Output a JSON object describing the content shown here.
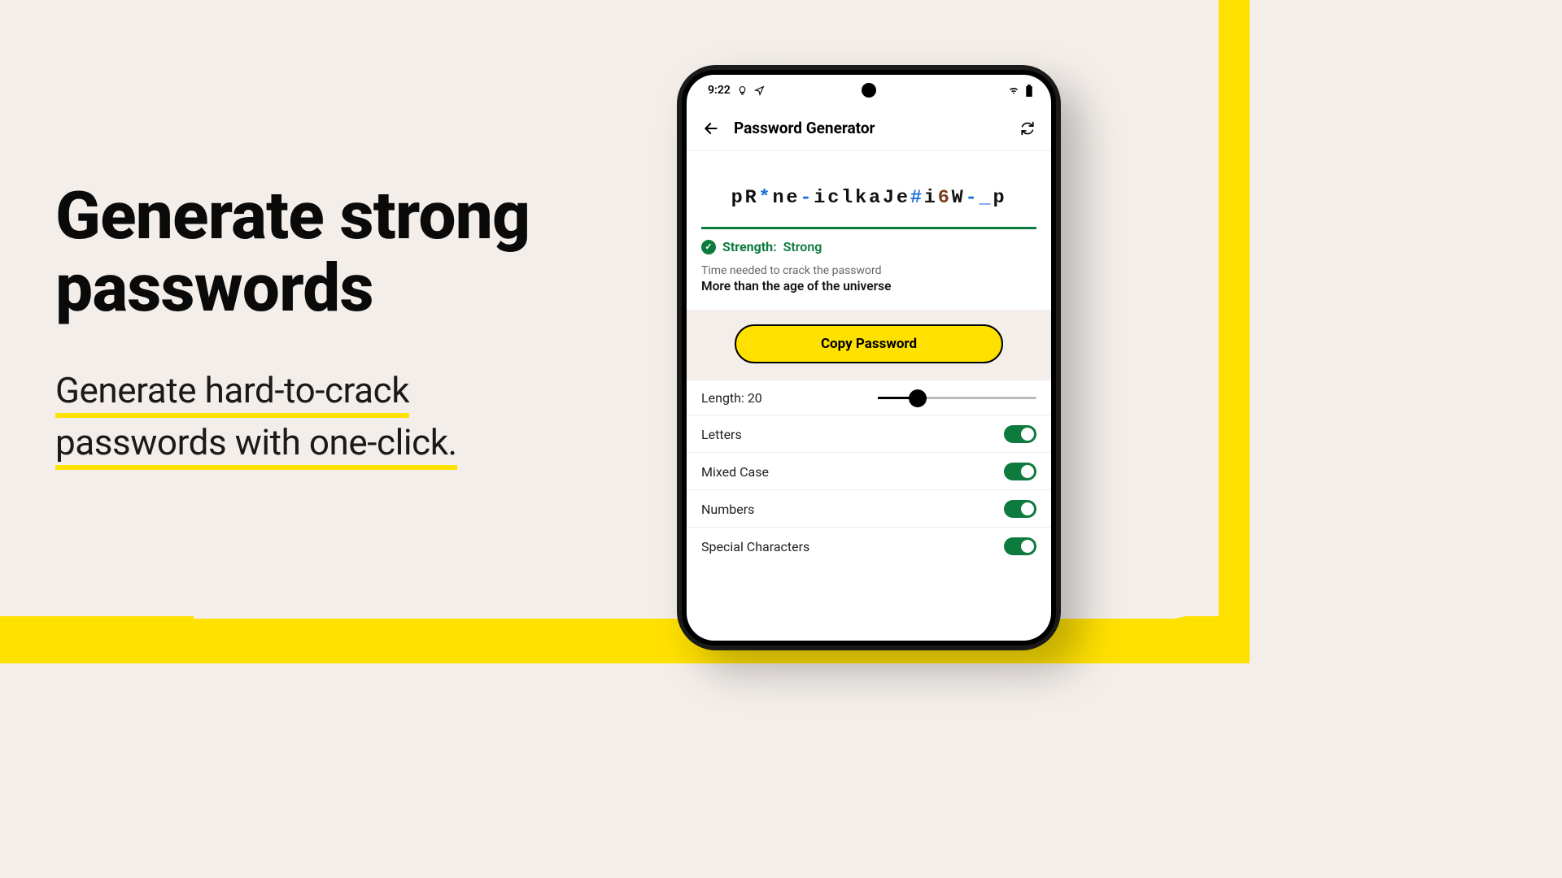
{
  "marketing": {
    "headline": "Generate strong passwords",
    "subhead_line1": "Generate hard-to-crack",
    "subhead_line2": "passwords with one-click."
  },
  "statusbar": {
    "time": "9:22"
  },
  "header": {
    "title": "Password Generator"
  },
  "password": {
    "value": "pR*ne-iclkaJe#i6W-_p",
    "strength_label": "Strength:",
    "strength_value": "Strong",
    "crack_label": "Time needed to crack the password",
    "crack_value": "More than the age of the universe"
  },
  "actions": {
    "copy": "Copy Password"
  },
  "options": {
    "length_label": "Length:",
    "length_value": "20",
    "letters": "Letters",
    "mixed": "Mixed Case",
    "numbers": "Numbers",
    "special": "Special Characters"
  }
}
